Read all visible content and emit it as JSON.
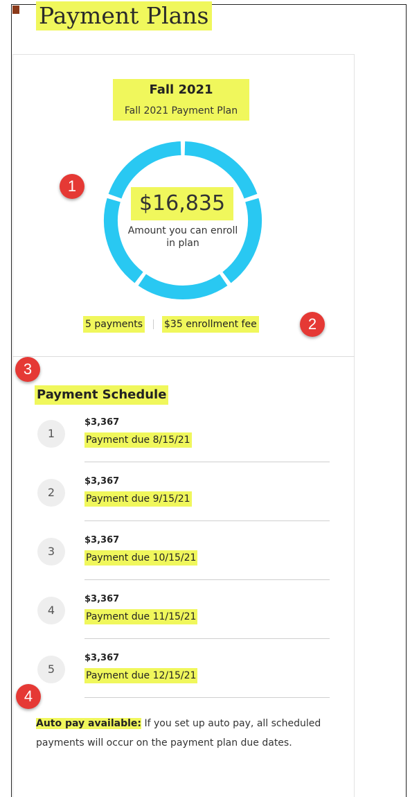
{
  "page": {
    "title": "Payment Plans"
  },
  "plan": {
    "term": "Fall 2021",
    "name": "Fall 2021 Payment Plan",
    "amount": "$16,835",
    "amount_caption": "Amount you can enroll in plan",
    "payments_count": "5 payments",
    "enrollment_fee": "$35 enrollment fee",
    "donut_color": "#29c8f2",
    "donut_segments": 5
  },
  "schedule": {
    "title": "Payment Schedule",
    "items": [
      {
        "number": "1",
        "amount": "$3,367",
        "due": "Payment due 8/15/21"
      },
      {
        "number": "2",
        "amount": "$3,367",
        "due": "Payment due 9/15/21"
      },
      {
        "number": "3",
        "amount": "$3,367",
        "due": "Payment due 10/15/21"
      },
      {
        "number": "4",
        "amount": "$3,367",
        "due": "Payment due 11/15/21"
      },
      {
        "number": "5",
        "amount": "$3,367",
        "due": "Payment due 12/15/21"
      }
    ]
  },
  "autopay": {
    "lead": "Auto pay available:",
    "text": " If you set up auto pay, all scheduled payments will occur on the payment plan due dates."
  },
  "callouts": {
    "one": "1",
    "two": "2",
    "three": "3",
    "four": "4",
    "color": "#e53935"
  },
  "colors": {
    "highlight": "#f0f75c"
  }
}
